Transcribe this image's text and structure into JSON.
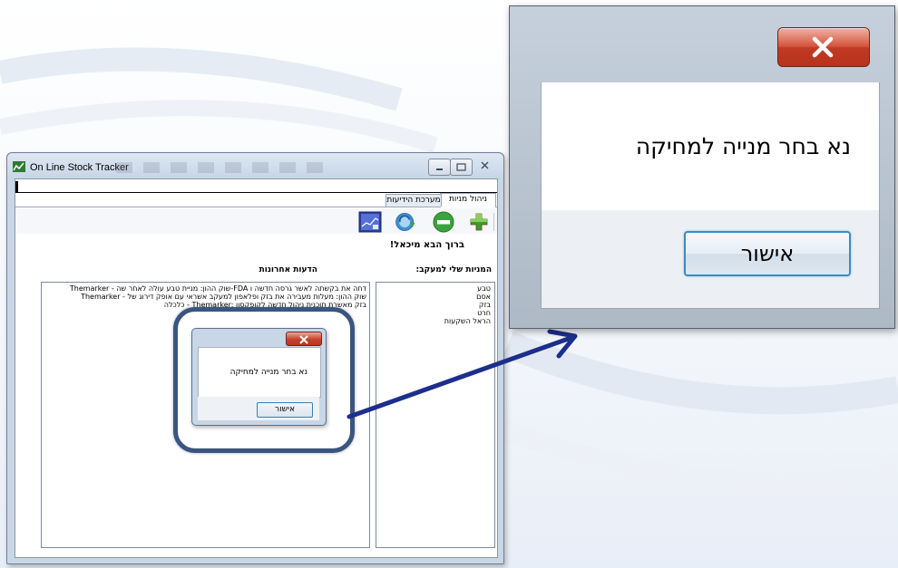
{
  "app": {
    "title": "On Line Stock Tracker",
    "tabs": [
      {
        "label": "ניהול מניות",
        "active": true
      },
      {
        "label": "מערכת הידיעות",
        "active": false
      }
    ],
    "toolbar": [
      {
        "name": "add-icon",
        "label": "add"
      },
      {
        "name": "remove-icon",
        "label": "remove"
      },
      {
        "name": "refresh-icon",
        "label": "refresh"
      },
      {
        "name": "chart-icon",
        "label": "chart"
      }
    ],
    "welcome": "ברוך הבא מיכאל!",
    "stocks_label": "המניות שלי למעקב:",
    "news_label": "הדעות אחרונות",
    "news": [
      "Themarker - שוק ההון: מניית טבע עולה לאחר שה-FDA דחה את בקשתה לאשר גרסה חדשה ו",
      "Themarker - שוק ההון: מעלות מעבירה את בזק ופלאפון למעקב אשראי עם אופק דירוג של",
      "כלכלה - Themarker: בזק מאשרת תוכנית ניהול חדשה לקופקסון"
    ],
    "stocks": [
      "טבע",
      "אסם",
      "בזק",
      "חרט",
      "הראל השקעות"
    ]
  },
  "dialog": {
    "message": "נא בחר מנייה למחיקה",
    "ok_label": "אישור",
    "close_icon": "close-icon"
  },
  "colors": {
    "close_red": "#c8412a",
    "highlight": "#3a5580",
    "arrow": "#1c2f8c",
    "ok_border": "#3c8bc3"
  }
}
